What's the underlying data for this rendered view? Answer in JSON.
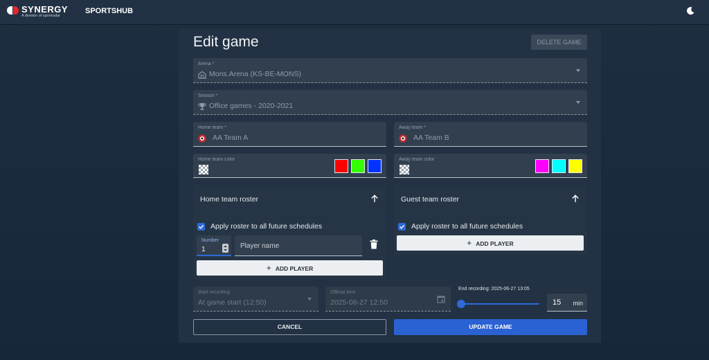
{
  "header": {
    "brand_name": "SYNERGY",
    "brand_sub": "A division of sportradar",
    "app_name": "SPORTSHUB",
    "theme_icon": "moon-icon"
  },
  "form": {
    "title": "Edit game",
    "delete_label": "DELETE GAME",
    "arena": {
      "label": "Arena *",
      "value": "Mons.Arena (KS-BE-MONS)",
      "icon": "arena-icon"
    },
    "season": {
      "label": "Season *",
      "value": "Office games - 2020-2021",
      "icon": "trophy-icon"
    },
    "home_team": {
      "label": "Home team *",
      "value": "AA Team A"
    },
    "away_team": {
      "label": "Away team *",
      "value": "AA Team B"
    },
    "home_color": {
      "label": "Home team color",
      "swatches": [
        "#ff0000",
        "#33ff00",
        "#0033ff"
      ]
    },
    "away_color": {
      "label": "Away team color",
      "swatches": [
        "#ff00ff",
        "#00ffff",
        "#ffff00"
      ]
    },
    "home_roster": {
      "title": "Home team roster",
      "apply_label": "Apply roster to all future schedules",
      "apply_checked": true,
      "player": {
        "number_label": "Number",
        "number_value": "1",
        "name_placeholder": "Player name"
      },
      "add_label": "ADD PLAYER"
    },
    "guest_roster": {
      "title": "Guest team roster",
      "apply_label": "Apply roster to all future schedules",
      "apply_checked": true,
      "add_label": "ADD PLAYER"
    },
    "start_recording": {
      "label": "Start recording",
      "value": "At game start (12:50)"
    },
    "official_time": {
      "label": "Official time",
      "value": "2025-06-27 12:50"
    },
    "end_recording": {
      "label": "End recording: 2025-06-27 13:05",
      "duration": "15",
      "unit": "min",
      "slider_fraction": 0.0
    },
    "cancel_label": "CANCEL",
    "update_label": "UPDATE GAME"
  },
  "colors": {
    "accent": "#2b62d3",
    "panel": "#223244",
    "field": "#323f4e"
  }
}
